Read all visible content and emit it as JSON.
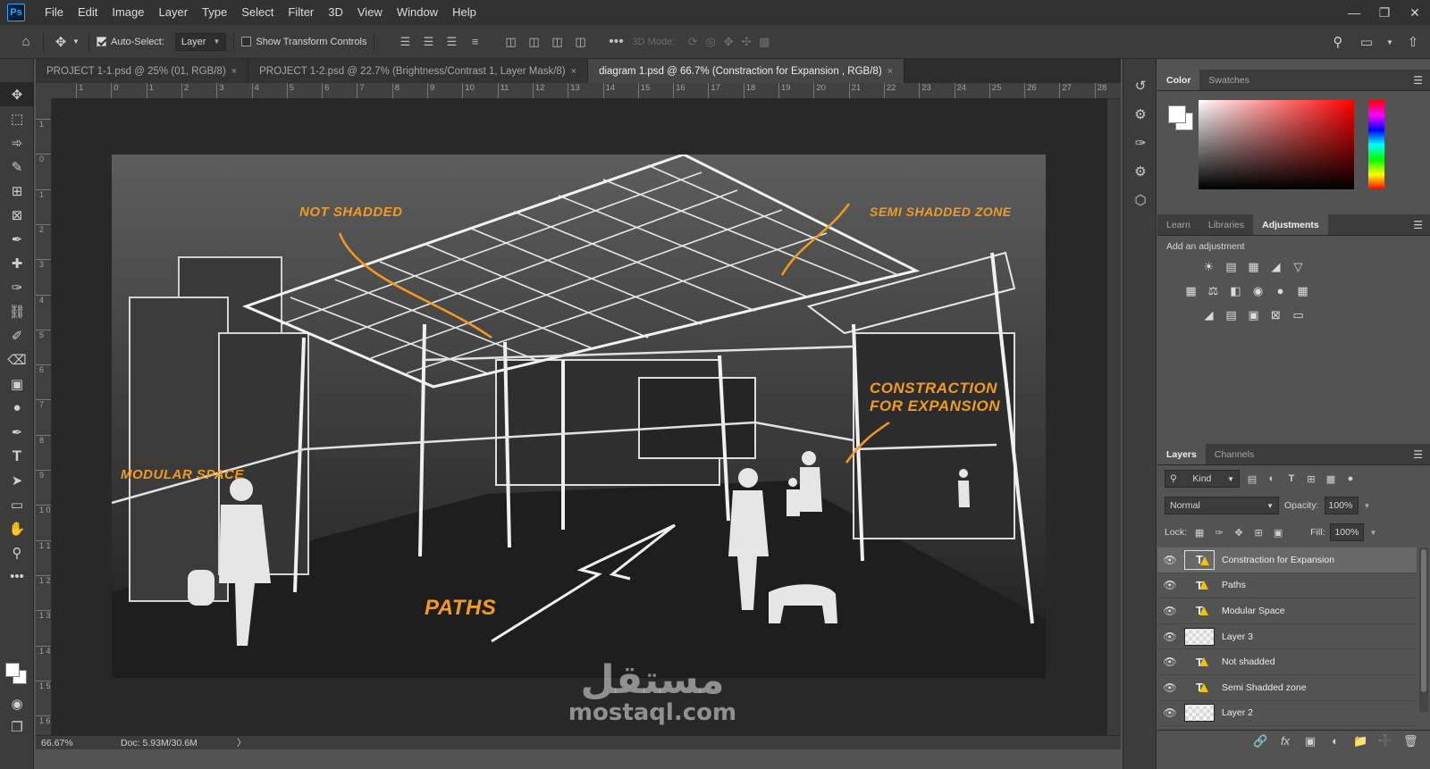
{
  "app": {
    "logo": "Ps"
  },
  "menu": [
    "File",
    "Edit",
    "Image",
    "Layer",
    "Type",
    "Select",
    "Filter",
    "3D",
    "View",
    "Window",
    "Help"
  ],
  "options": {
    "auto_select_label": "Auto-Select:",
    "auto_select_checked": true,
    "auto_select_target": "Layer",
    "transform_controls_label": "Show Transform Controls",
    "transform_controls_checked": false,
    "mode_3d_label": "3D Mode:"
  },
  "tabs": [
    {
      "label": "PROJECT 1-1.psd @ 25% (01, RGB/8)",
      "close": "×",
      "active": false
    },
    {
      "label": "PROJECT 1-2.psd @ 22.7% (Brightness/Contrast 1, Layer Mask/8)",
      "close": "×",
      "active": false
    },
    {
      "label": "diagram 1.psd @ 66.7% (Constraction  for Expansion , RGB/8)",
      "close": "×",
      "active": true
    }
  ],
  "ruler_top": [
    "1",
    "0",
    "1",
    "2",
    "3",
    "4",
    "5",
    "6",
    "7",
    "8",
    "9",
    "10",
    "11",
    "12",
    "13",
    "14",
    "15",
    "16",
    "17",
    "18",
    "19",
    "20",
    "21",
    "22",
    "23",
    "24",
    "25",
    "26",
    "27",
    "28"
  ],
  "ruler_left": [
    "1",
    "0",
    "1",
    "2",
    "3",
    "4",
    "5",
    "6",
    "7",
    "8",
    "9",
    "1 0",
    "1 1",
    "1 2",
    "1 3",
    "1 4",
    "1 5",
    "1 6"
  ],
  "annotations": {
    "not_shadded": "Not shadded",
    "semi_shadded": "Semi shadded zone",
    "construction_line1": "Constraction",
    "construction_line2": "for Expansion",
    "modular": "Modular space",
    "paths": "Paths"
  },
  "watermark": {
    "arabic": "مستقل",
    "latin": "mostaql.com"
  },
  "status": {
    "zoom": "66.67%",
    "doc": "Doc: 5.93M/30.6M",
    "arrow": "〉"
  },
  "color_panel": {
    "tabs": [
      "Color",
      "Swatches"
    ],
    "active": "Color"
  },
  "adjustments_panel": {
    "tabs": [
      "Learn",
      "Libraries",
      "Adjustments"
    ],
    "active": "Adjustments",
    "title": "Add an adjustment"
  },
  "layers_panel": {
    "tabs": [
      "Layers",
      "Channels"
    ],
    "active": "Layers",
    "filter": "Kind",
    "blend_mode": "Normal",
    "opacity_label": "Opacity:",
    "opacity": "100%",
    "lock_label": "Lock:",
    "fill_label": "Fill:",
    "fill": "100%",
    "layers": [
      {
        "name": "Constraction  for Expansion",
        "kind": "text",
        "selected": true
      },
      {
        "name": "Paths",
        "kind": "text",
        "selected": false
      },
      {
        "name": "Modular Space",
        "kind": "text",
        "selected": false
      },
      {
        "name": "Layer 3",
        "kind": "image",
        "selected": false
      },
      {
        "name": "Not shadded",
        "kind": "text",
        "selected": false
      },
      {
        "name": "Semi Shadded zone",
        "kind": "text",
        "selected": false
      },
      {
        "name": "Layer 2",
        "kind": "image",
        "selected": false
      }
    ]
  },
  "colors": {
    "accent_orange": "#f29b1f",
    "panel": "#535353",
    "chrome": "#3c3c3c",
    "canvas_bg": "#282828"
  }
}
